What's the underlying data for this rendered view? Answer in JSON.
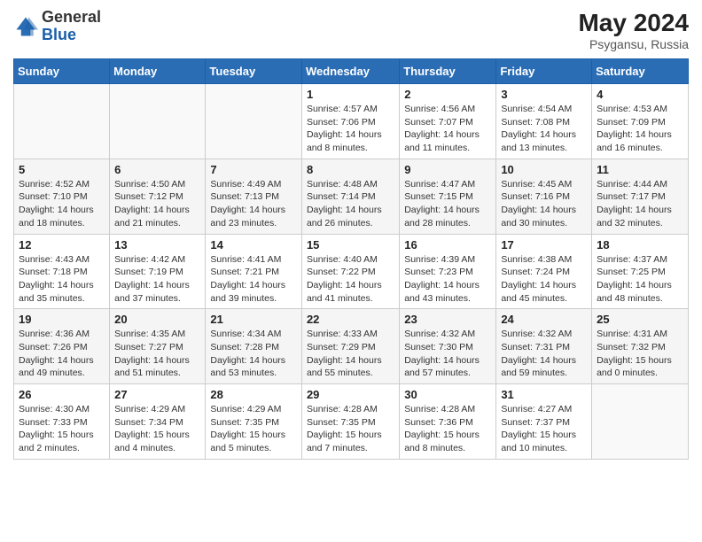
{
  "header": {
    "logo_general": "General",
    "logo_blue": "Blue",
    "month_year": "May 2024",
    "location": "Psygansu, Russia"
  },
  "weekdays": [
    "Sunday",
    "Monday",
    "Tuesday",
    "Wednesday",
    "Thursday",
    "Friday",
    "Saturday"
  ],
  "weeks": [
    [
      {
        "day": "",
        "info": ""
      },
      {
        "day": "",
        "info": ""
      },
      {
        "day": "",
        "info": ""
      },
      {
        "day": "1",
        "info": "Sunrise: 4:57 AM\nSunset: 7:06 PM\nDaylight: 14 hours\nand 8 minutes."
      },
      {
        "day": "2",
        "info": "Sunrise: 4:56 AM\nSunset: 7:07 PM\nDaylight: 14 hours\nand 11 minutes."
      },
      {
        "day": "3",
        "info": "Sunrise: 4:54 AM\nSunset: 7:08 PM\nDaylight: 14 hours\nand 13 minutes."
      },
      {
        "day": "4",
        "info": "Sunrise: 4:53 AM\nSunset: 7:09 PM\nDaylight: 14 hours\nand 16 minutes."
      }
    ],
    [
      {
        "day": "5",
        "info": "Sunrise: 4:52 AM\nSunset: 7:10 PM\nDaylight: 14 hours\nand 18 minutes."
      },
      {
        "day": "6",
        "info": "Sunrise: 4:50 AM\nSunset: 7:12 PM\nDaylight: 14 hours\nand 21 minutes."
      },
      {
        "day": "7",
        "info": "Sunrise: 4:49 AM\nSunset: 7:13 PM\nDaylight: 14 hours\nand 23 minutes."
      },
      {
        "day": "8",
        "info": "Sunrise: 4:48 AM\nSunset: 7:14 PM\nDaylight: 14 hours\nand 26 minutes."
      },
      {
        "day": "9",
        "info": "Sunrise: 4:47 AM\nSunset: 7:15 PM\nDaylight: 14 hours\nand 28 minutes."
      },
      {
        "day": "10",
        "info": "Sunrise: 4:45 AM\nSunset: 7:16 PM\nDaylight: 14 hours\nand 30 minutes."
      },
      {
        "day": "11",
        "info": "Sunrise: 4:44 AM\nSunset: 7:17 PM\nDaylight: 14 hours\nand 32 minutes."
      }
    ],
    [
      {
        "day": "12",
        "info": "Sunrise: 4:43 AM\nSunset: 7:18 PM\nDaylight: 14 hours\nand 35 minutes."
      },
      {
        "day": "13",
        "info": "Sunrise: 4:42 AM\nSunset: 7:19 PM\nDaylight: 14 hours\nand 37 minutes."
      },
      {
        "day": "14",
        "info": "Sunrise: 4:41 AM\nSunset: 7:21 PM\nDaylight: 14 hours\nand 39 minutes."
      },
      {
        "day": "15",
        "info": "Sunrise: 4:40 AM\nSunset: 7:22 PM\nDaylight: 14 hours\nand 41 minutes."
      },
      {
        "day": "16",
        "info": "Sunrise: 4:39 AM\nSunset: 7:23 PM\nDaylight: 14 hours\nand 43 minutes."
      },
      {
        "day": "17",
        "info": "Sunrise: 4:38 AM\nSunset: 7:24 PM\nDaylight: 14 hours\nand 45 minutes."
      },
      {
        "day": "18",
        "info": "Sunrise: 4:37 AM\nSunset: 7:25 PM\nDaylight: 14 hours\nand 48 minutes."
      }
    ],
    [
      {
        "day": "19",
        "info": "Sunrise: 4:36 AM\nSunset: 7:26 PM\nDaylight: 14 hours\nand 49 minutes."
      },
      {
        "day": "20",
        "info": "Sunrise: 4:35 AM\nSunset: 7:27 PM\nDaylight: 14 hours\nand 51 minutes."
      },
      {
        "day": "21",
        "info": "Sunrise: 4:34 AM\nSunset: 7:28 PM\nDaylight: 14 hours\nand 53 minutes."
      },
      {
        "day": "22",
        "info": "Sunrise: 4:33 AM\nSunset: 7:29 PM\nDaylight: 14 hours\nand 55 minutes."
      },
      {
        "day": "23",
        "info": "Sunrise: 4:32 AM\nSunset: 7:30 PM\nDaylight: 14 hours\nand 57 minutes."
      },
      {
        "day": "24",
        "info": "Sunrise: 4:32 AM\nSunset: 7:31 PM\nDaylight: 14 hours\nand 59 minutes."
      },
      {
        "day": "25",
        "info": "Sunrise: 4:31 AM\nSunset: 7:32 PM\nDaylight: 15 hours\nand 0 minutes."
      }
    ],
    [
      {
        "day": "26",
        "info": "Sunrise: 4:30 AM\nSunset: 7:33 PM\nDaylight: 15 hours\nand 2 minutes."
      },
      {
        "day": "27",
        "info": "Sunrise: 4:29 AM\nSunset: 7:34 PM\nDaylight: 15 hours\nand 4 minutes."
      },
      {
        "day": "28",
        "info": "Sunrise: 4:29 AM\nSunset: 7:35 PM\nDaylight: 15 hours\nand 5 minutes."
      },
      {
        "day": "29",
        "info": "Sunrise: 4:28 AM\nSunset: 7:35 PM\nDaylight: 15 hours\nand 7 minutes."
      },
      {
        "day": "30",
        "info": "Sunrise: 4:28 AM\nSunset: 7:36 PM\nDaylight: 15 hours\nand 8 minutes."
      },
      {
        "day": "31",
        "info": "Sunrise: 4:27 AM\nSunset: 7:37 PM\nDaylight: 15 hours\nand 10 minutes."
      },
      {
        "day": "",
        "info": ""
      }
    ]
  ]
}
